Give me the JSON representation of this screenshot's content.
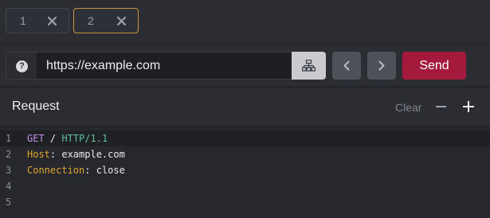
{
  "tabs": [
    {
      "number": "1",
      "active": false
    },
    {
      "number": "2",
      "active": true
    }
  ],
  "url_bar": {
    "help_glyph": "?",
    "url_value": "https://example.com",
    "send_label": "Send",
    "network_icon": "network-icon",
    "prev_icon": "chevron-left-icon",
    "next_icon": "chevron-right-icon"
  },
  "request": {
    "title": "Request",
    "clear_label": "Clear"
  },
  "editor": {
    "line_numbers": [
      "1",
      "2",
      "3",
      "4",
      "5"
    ],
    "method": "GET",
    "path": " / ",
    "protocol": "HTTP/1.1",
    "header1_key": "Host",
    "header1_value": ": example.com",
    "header2_key": "Connection",
    "header2_value": ": close"
  },
  "colors": {
    "accent_tab_border": "#c9953f",
    "send_button": "#a41a3c",
    "method": "#c592e6",
    "protocol": "#5fc39a",
    "header_key": "#e0a62c"
  }
}
